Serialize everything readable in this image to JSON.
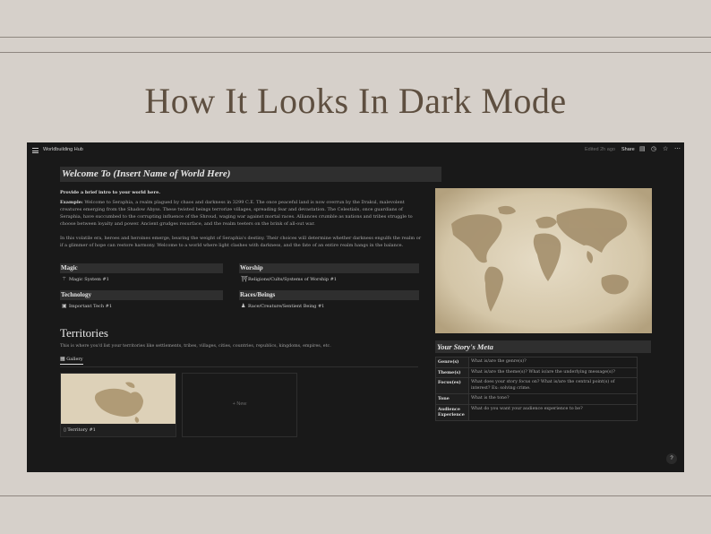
{
  "banner": {
    "headline": "How It Looks In Dark Mode"
  },
  "topbar": {
    "workspace_title": "Worldbuilding Hub",
    "edited": "Edited 2h ago",
    "share_label": "Share",
    "icons": [
      "comment-icon",
      "clock-icon",
      "star-icon",
      "more-icon"
    ]
  },
  "page": {
    "title": "Welcome To (Insert Name of World Here)",
    "intro_heading": "Provide a brief intro to your world here.",
    "example_label": "Example:",
    "example_text": "Welcome to Seraphia, a realm plagued by chaos and darkness in 3299 C.E. The once peaceful land is now overrun by the Drakul, malevolent creatures emerging from the Shadow Abyss. These twisted beings terrorize villages, spreading fear and devastation. The Celestials, once guardians of Seraphia, have succumbed to the corrupting influence of the Shroud, waging war against mortal races. Alliances crumble as nations and tribes struggle to choose between loyalty and power. Ancient grudges resurface, and the realm teeters on the brink of all-out war.",
    "paragraph2": "In this volatile era, heroes and heroines emerge, bearing the weight of Seraphia's destiny. Their choices will determine whether darkness engulfs the realm or if a glimmer of hope can restore harmony. Welcome to a world where light clashes with darkness, and the fate of an entire realm hangs in the balance."
  },
  "sections": {
    "magic": {
      "heading": "Magic",
      "item": "Magic System #1"
    },
    "worship": {
      "heading": "Worship",
      "item": "Religions/Cults/Systems of Worship #1"
    },
    "technology": {
      "heading": "Technology",
      "item": "Important Tech #1"
    },
    "races": {
      "heading": "Races/Beings",
      "item": "Race/Creature/Sentient Being #1"
    }
  },
  "territories": {
    "heading": "Territories",
    "description": "This is where you'd list your territories like settlements, tribes, villages, cities, countries, republics, kingdoms, empires, etc.",
    "tab_label": "Gallery",
    "card_label": "Territory #1",
    "new_label": "+ New"
  },
  "meta": {
    "heading": "Your Story's Meta",
    "rows": [
      {
        "key": "Genre(s)",
        "value": "What is/are the genre(s)?"
      },
      {
        "key": "Theme(s)",
        "value": "What is/are the theme(s)? What is/are the underlying message(s)?"
      },
      {
        "key": "Focus(es)",
        "value": "What does your story focus on? What is/are the central point(s) of interest? Ex: solving crime."
      },
      {
        "key": "Tone",
        "value": "What is the tone?"
      },
      {
        "key": "Audience Experience",
        "value": "What do you want your audience experience to be?"
      }
    ]
  },
  "help_label": "?",
  "colors": {
    "banner_bg": "#d6d0ca",
    "app_bg": "#191919",
    "heading_bg": "#2f2f2f",
    "map_parchment": "#d9cdb4"
  }
}
